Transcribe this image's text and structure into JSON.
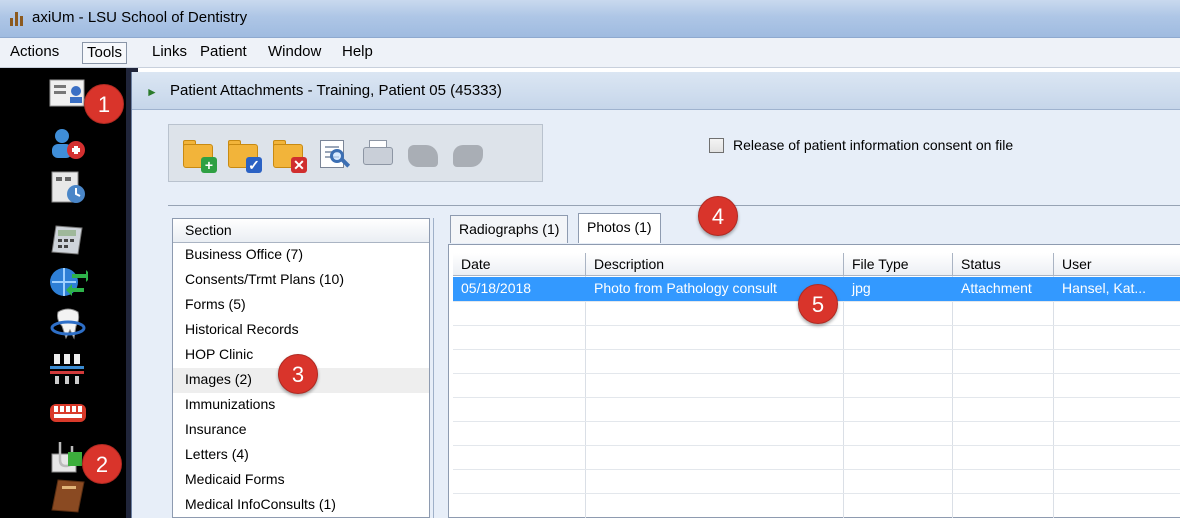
{
  "window": {
    "title": "axiUm - LSU School of Dentistry"
  },
  "menu": {
    "items": [
      "Actions",
      "Tools",
      "Links",
      "Patient",
      "Window",
      "Help"
    ]
  },
  "dock": {
    "icons": [
      "patient-card-icon",
      "add-patient-icon",
      "calendar-clock-icon",
      "calculator-icon",
      "globe-transfer-icon",
      "tooth-icon",
      "implant-rack-icon",
      "dentures-icon",
      "paperclip-attachments-icon",
      "notebook-icon"
    ]
  },
  "attachments_window": {
    "title": "Patient Attachments - Training, Patient 05 (45333)",
    "consent_label": "Release of patient information consent on file",
    "consent_checked": false
  },
  "toolbar": {
    "buttons": [
      "add-folder",
      "approve-folder",
      "delete-folder",
      "preview",
      "print",
      "disabled-1",
      "disabled-2"
    ]
  },
  "sections": {
    "header": "Section",
    "items": [
      "Business Office (7)",
      "Consents/Trmt Plans (10)",
      "Forms (5)",
      "Historical Records",
      "HOP Clinic",
      "Images (2)",
      "Immunizations",
      "Insurance",
      "Letters (4)",
      "Medicaid Forms",
      "Medical InfoConsults (1)"
    ],
    "selected_index": 5
  },
  "tabs": [
    "Radiographs (1)",
    "Photos (1)"
  ],
  "active_tab": 1,
  "grid": {
    "columns": [
      "Date",
      "Description",
      "File Type",
      "Status",
      "User"
    ],
    "rows": [
      [
        "05/18/2018",
        "Photo from Pathology consult",
        "jpg",
        "Attachment",
        "Hansel, Kat..."
      ]
    ]
  },
  "callouts": [
    "1",
    "2",
    "3",
    "4",
    "5"
  ],
  "colors": {
    "selection": "#3399ff",
    "callout": "#d9342b",
    "dock": "#000000"
  }
}
